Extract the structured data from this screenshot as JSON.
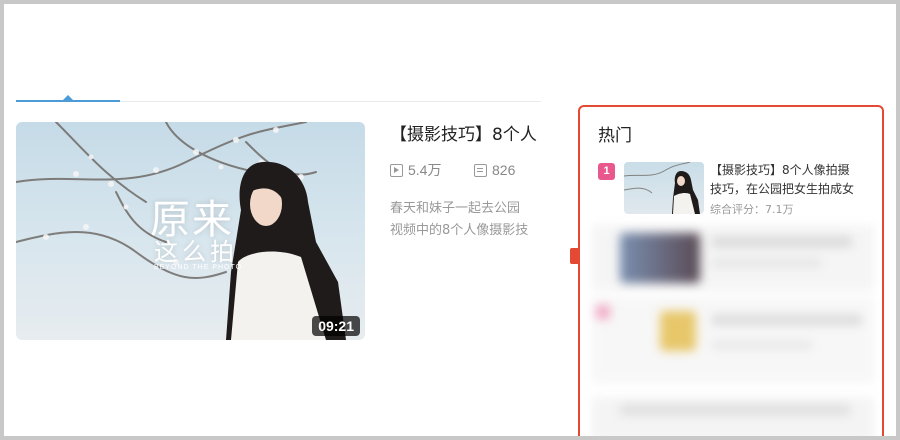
{
  "video": {
    "title": "【摄影技巧】8个人",
    "duration": "09:21",
    "thumb_title_line1": "原来",
    "thumb_title_line2": "这么拍",
    "thumb_subtitle": "BEYOND THE PHOTO",
    "views": "5.4万",
    "comments": "826",
    "desc_line1": "春天和妹子一起去公园",
    "desc_line2": "视频中的8个人像摄影技"
  },
  "hot": {
    "title": "热门",
    "items": [
      {
        "rank": "1",
        "title": "【摄影技巧】8个人像拍摄技巧，在公园把女生拍成女",
        "meta": "综合评分：7.1万"
      }
    ]
  },
  "colors": {
    "accent_blue": "#4d9bd7",
    "hot_border": "#e44a33",
    "rank_badge": "#e8588d"
  },
  "icons": [
    "play-icon",
    "comment-icon"
  ]
}
